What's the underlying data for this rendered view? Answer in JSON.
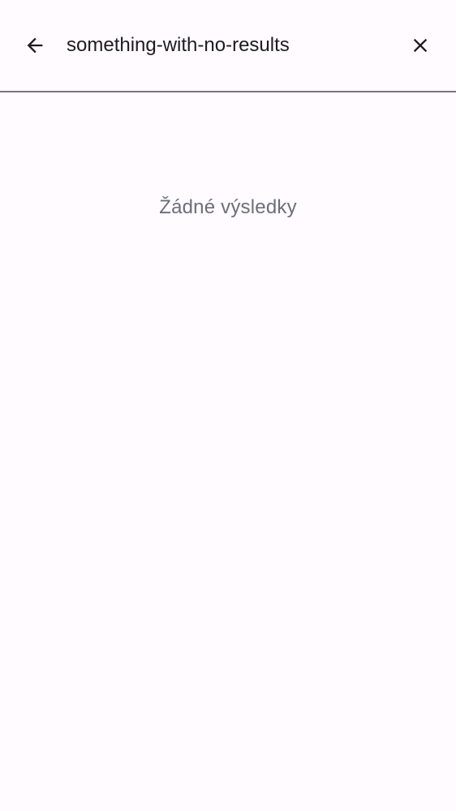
{
  "search": {
    "query": "something-with-no-results",
    "back_icon": "arrow-back-icon",
    "clear_icon": "close-icon"
  },
  "results": {
    "empty_text": "Žádné výsledky",
    "count": 0
  },
  "colors": {
    "background": "#fffbfe",
    "text": "#1d1b20",
    "muted_text": "#6b6f78",
    "divider": "#79747e"
  }
}
